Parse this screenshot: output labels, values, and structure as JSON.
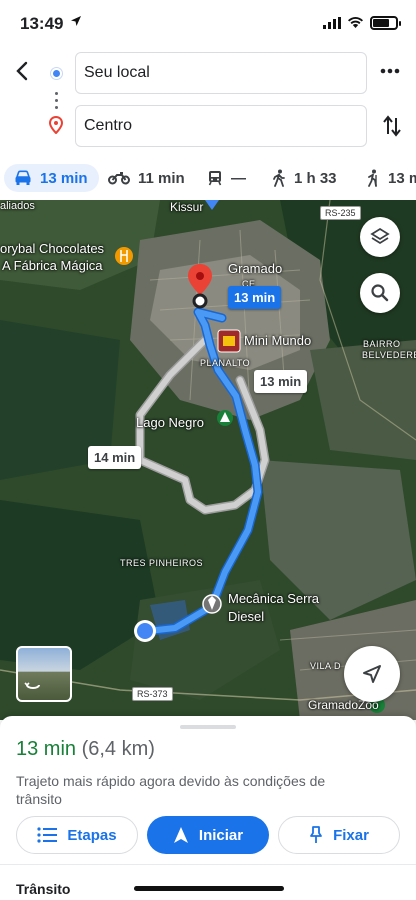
{
  "status_bar": {
    "time": "13:49"
  },
  "directions": {
    "origin": "Seu local",
    "destination": "Centro"
  },
  "travel_modes": [
    {
      "icon": "car-icon",
      "label": "13 min",
      "active": true
    },
    {
      "icon": "motorcycle-icon",
      "label": "11 min",
      "active": false
    },
    {
      "icon": "transit-icon",
      "label": "—",
      "active": false
    },
    {
      "icon": "walk-icon",
      "label": "1 h 33",
      "active": false
    },
    {
      "icon": "wheelchair-icon",
      "label": "13 m",
      "active": false
    }
  ],
  "map": {
    "labels": {
      "aliados": "aliados",
      "chocolates_1": "orybal Chocolates",
      "chocolates_2": "A Fábrica Mágica",
      "gramado": "Gramado",
      "mini_mundo": "Mini Mundo",
      "planalto": "PLANALTO",
      "bairro_belvedere_1": "BAIRRO",
      "bairro_belvedere_2": "BELVEDERE",
      "lago_negro": "Lago Negro",
      "tres_pinheiros": "TRES PINHEIROS",
      "mecanica_1": "Mecânica Serra",
      "mecanica_2": "Diesel",
      "vila_do": "VILA D",
      "gramado_zoo": "GramadoZoo",
      "kissur": "Kissur",
      "ce": "CE"
    },
    "road_signs": {
      "rs235": "RS-235",
      "rs373": "RS-373"
    },
    "route_labels": {
      "primary": "13 min",
      "alt_1": "13 min",
      "alt_2": "14 min"
    },
    "colors": {
      "route_primary": "#4285f4",
      "route_alternate": "#bdbdbd",
      "destination_pin": "#ea4335"
    }
  },
  "sheet": {
    "time": "13 min",
    "distance": "(6,4 km)",
    "note": "Trajeto mais rápido agora devido às condições de trânsito",
    "buttons": {
      "steps": "Etapas",
      "start": "Iniciar",
      "pin": "Fixar"
    },
    "traffic_label": "Trânsito"
  }
}
